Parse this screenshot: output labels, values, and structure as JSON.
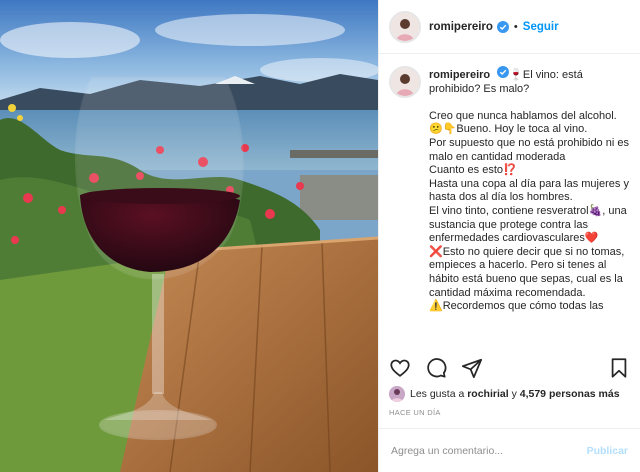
{
  "header": {
    "username": "romipereiro",
    "follow_label": "Seguir",
    "separator": "•"
  },
  "caption": {
    "username": "romipereiro",
    "text": "🍷El vino: está prohibido? Es malo?\n\nCreo que nunca hablamos del alcohol.\n😕👇Bueno. Hoy le toca al vino.\nPor supuesto que no está prohibido ni es malo en cantidad moderada\nCuanto es esto⁉️\nHasta una copa al día para las mujeres y hasta dos al día los hombres.\nEl vino tinto, contiene resveratrol🍇, una sustancia que protege contra las enfermedades cardiovasculares❤️\n❌Esto no quiere decir que si no tomas, empieces a hacerlo. Pero si tenes al hábito está bueno que sepas, cual es la cantidad máxima recomendada.\n⚠️Recordemos que cómo todas las"
  },
  "actions": {
    "like_icon": "heart-icon",
    "comment_icon": "comment-icon",
    "share_icon": "share-icon",
    "save_icon": "bookmark-icon"
  },
  "likes": {
    "prefix": "Les gusta a",
    "liker": "rochirial",
    "middle": "y",
    "count": "4,579 personas más"
  },
  "timestamp": "HACE UN DÍA",
  "comment_box": {
    "placeholder": "Agrega un comentario...",
    "publish_label": "Publicar"
  },
  "colors": {
    "accent": "#0095f6",
    "publish_disabled": "#b2dffc",
    "muted": "#8e8e8e",
    "text": "#262626"
  }
}
